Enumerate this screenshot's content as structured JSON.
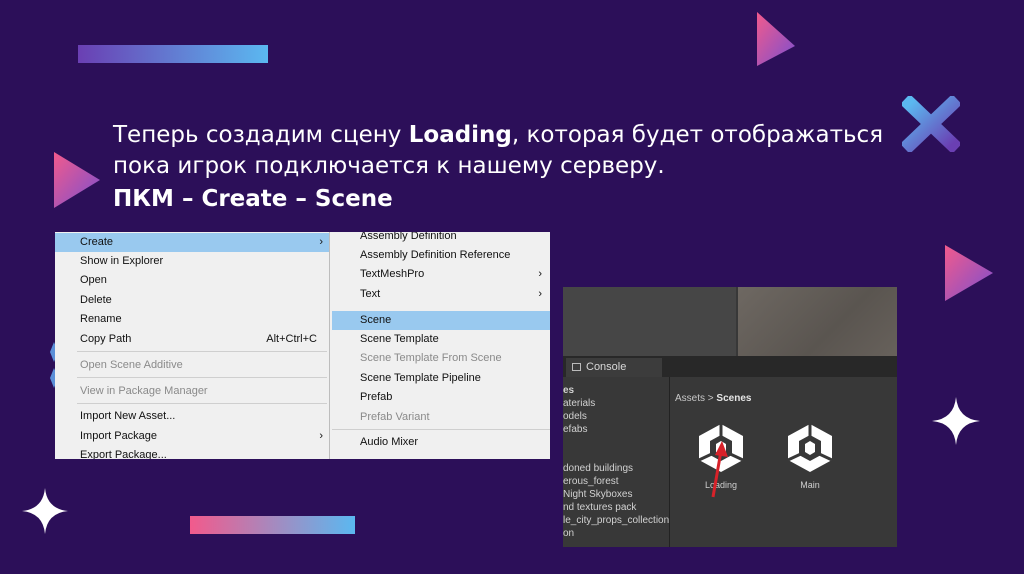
{
  "slide": {
    "heading_line1_pre": "Теперь создадим сцену ",
    "heading_line1_bold": "Loading",
    "heading_line1_post": ", которая будет отображаться",
    "heading_line2": "пока игрок подключается к нашему серверу.",
    "subheading": "ПКМ – Create – Scene"
  },
  "context_menu": {
    "items": [
      {
        "label": "Create",
        "arrow": "›",
        "selected": true
      },
      {
        "label": "Show in Explorer"
      },
      {
        "label": "Open"
      },
      {
        "label": "Delete"
      },
      {
        "label": "Rename"
      },
      {
        "label": "Copy Path",
        "shortcut": "Alt+Ctrl+C"
      },
      {
        "label": "Open Scene Additive",
        "disabled": true
      },
      {
        "label": "View in Package Manager",
        "disabled": true
      },
      {
        "label": "Import New Asset..."
      },
      {
        "label": "Import Package",
        "arrow": "›"
      },
      {
        "label": "Export Package..."
      }
    ]
  },
  "submenu": {
    "items": [
      {
        "label": "Assembly Definition"
      },
      {
        "label": "Assembly Definition Reference"
      },
      {
        "label": "TextMeshPro",
        "arrow": "›"
      },
      {
        "label": "Text",
        "arrow": "›"
      },
      {
        "label": "Scene",
        "selected": true
      },
      {
        "label": "Scene Template"
      },
      {
        "label": "Scene Template From Scene",
        "disabled": true
      },
      {
        "label": "Scene Template Pipeline"
      },
      {
        "label": "Prefab"
      },
      {
        "label": "Prefab Variant",
        "disabled": true
      },
      {
        "label": "Audio Mixer"
      }
    ]
  },
  "unity": {
    "console_tab": "Console",
    "folders": [
      "es",
      "aterials",
      "odels",
      "efabs",
      "doned buildings",
      "erous_forest",
      "Night Skyboxes",
      "nd textures pack",
      "le_city_props_collection",
      "on"
    ],
    "breadcrumb_root": "Assets",
    "breadcrumb_sep": ">",
    "breadcrumb_current": "Scenes",
    "assets": [
      "Loading",
      "Main"
    ]
  },
  "colors": {
    "background": "#2c0f59",
    "menu_highlight": "#99c9ef",
    "accent_pink": "#f25a8c",
    "accent_blue": "#5bb8f0",
    "arrow_red": "#d8222a"
  }
}
